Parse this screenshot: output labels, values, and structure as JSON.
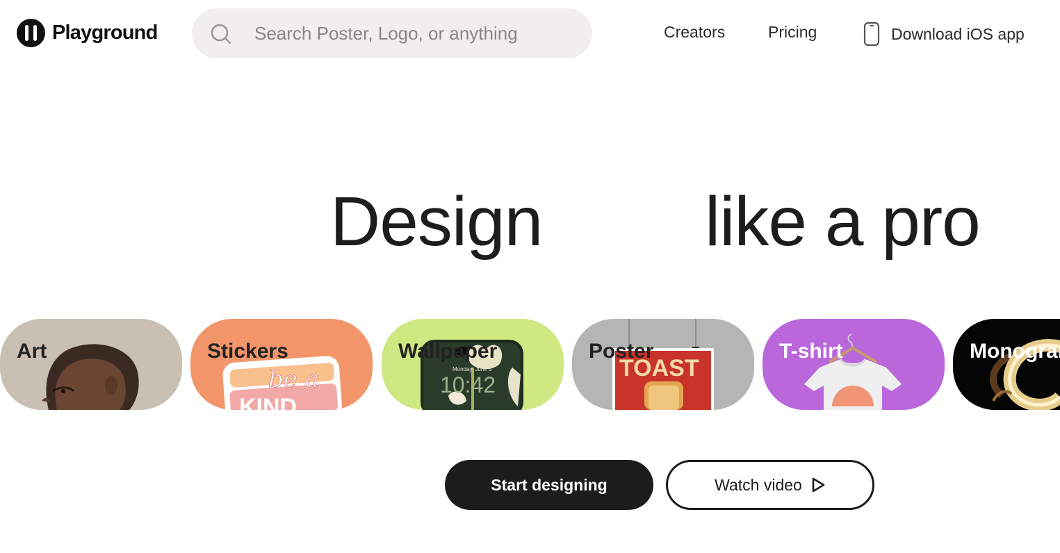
{
  "header": {
    "logo_text": "Playground",
    "search_placeholder": "Search Poster, Logo, or anything",
    "nav": {
      "creators": "Creators",
      "pricing": "Pricing",
      "download": "Download iOS app"
    }
  },
  "hero": {
    "line_left": "Design",
    "line_right": "like a pro"
  },
  "categories": [
    {
      "label": "Art",
      "color": "#c9bfb3"
    },
    {
      "label": "Stickers",
      "color": "#f2956a",
      "art_text_1": "be a",
      "art_text_2": "KIND"
    },
    {
      "label": "Wallpaper",
      "color": "#cfe882",
      "art_text_1": "Monday, June 6",
      "art_text_2": "10:42"
    },
    {
      "label": "Poster",
      "color": "#b5b5b5",
      "art_text_1": "TOAST"
    },
    {
      "label": "T-shirt",
      "color": "#b967da"
    },
    {
      "label": "Monogram",
      "color": "#050505"
    }
  ],
  "cta": {
    "start": "Start designing",
    "watch": "Watch video"
  },
  "colors": {
    "brand_dark": "#1c1c1c",
    "search_bg": "#f0efed"
  }
}
